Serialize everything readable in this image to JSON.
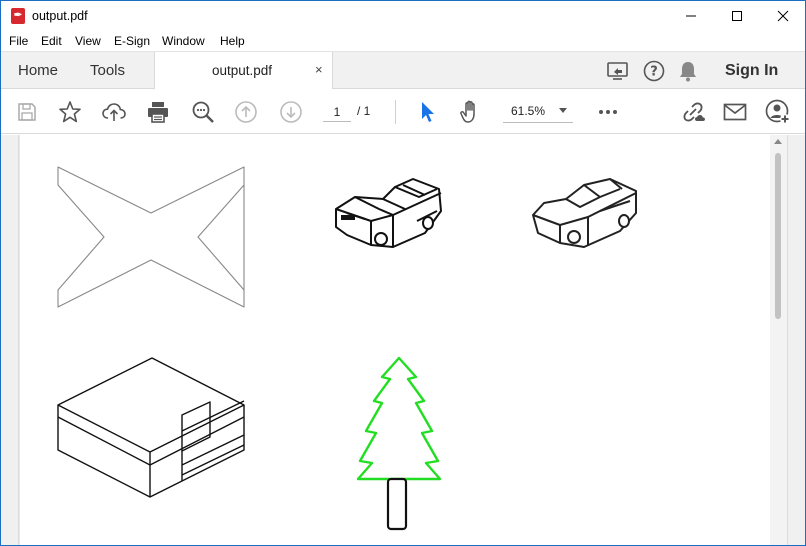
{
  "window": {
    "title": "output.pdf",
    "app_icon": "acrobat-icon",
    "controls": [
      "minimize-icon",
      "maximize-icon",
      "close-icon"
    ]
  },
  "menu": [
    "File",
    "Edit",
    "View",
    "E-Sign",
    "Window",
    "Help"
  ],
  "tabs": {
    "home": "Home",
    "tools": "Tools",
    "document": "output.pdf",
    "close": "×",
    "sign_in": "Sign In",
    "icons": [
      "share-screen-icon",
      "help-icon",
      "notification-bell-icon"
    ]
  },
  "toolbar": {
    "icons": [
      "save-icon",
      "bookmark-star-icon",
      "upload-cloud-icon",
      "print-icon",
      "zoom-search-icon",
      "page-up-icon",
      "page-down-icon",
      "select-cursor-icon",
      "hand-tool-icon",
      "more-options-icon",
      "share-link-icon",
      "email-icon",
      "add-user-icon"
    ],
    "page_current": "1",
    "page_total": "/ 1",
    "zoom": "61.5%"
  },
  "document": {
    "drawings": [
      "x-shape-outline",
      "car-sketch-1",
      "car-sketch-2",
      "isometric-box-drawing",
      "green-tree-drawing"
    ],
    "accent_colors": {
      "tree": "#22dd22",
      "selected_tool": "#1a73e8"
    }
  }
}
